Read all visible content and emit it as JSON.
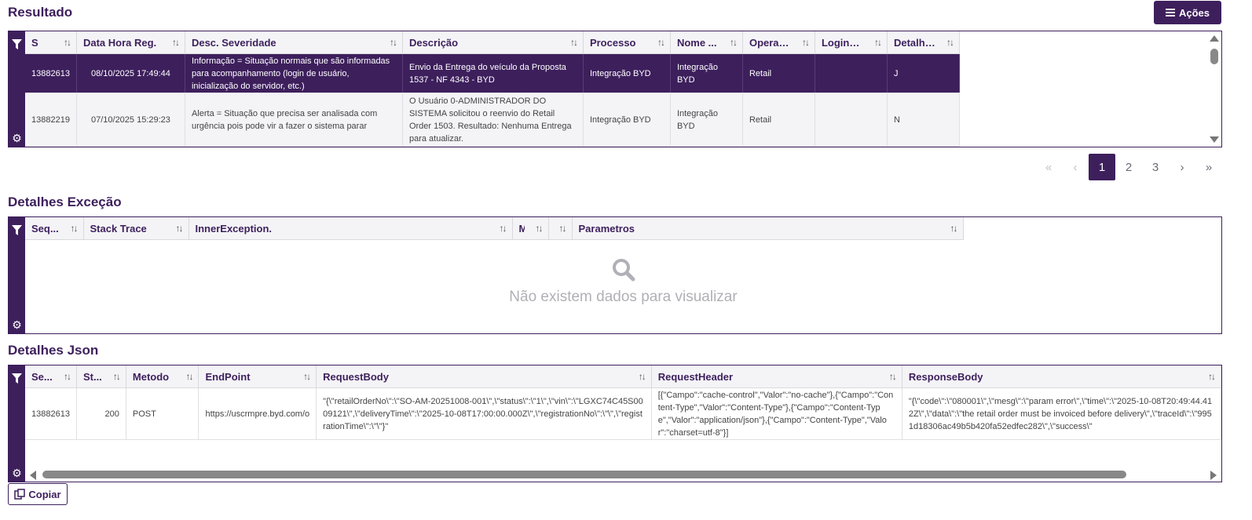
{
  "resultado": {
    "title": "Resultado",
    "acoes_label": "Ações",
    "columns": [
      "S",
      "Data Hora Reg.",
      "Desc. Severidade",
      "Descrição",
      "Processo",
      "Nome ...",
      "Operaç...",
      "LoginU...",
      "Detalhes"
    ],
    "rows": [
      {
        "s": "13882613",
        "data": "08/10/2025 17:49:44",
        "severidade": "Informação = Situação normais que são informadas para acompanhamento (login de usuário, inicialização do servidor, etc.)",
        "descricao": "Envio da Entrega do veículo da Proposta 1537 - NF 4343 - BYD",
        "processo": "Integração BYD",
        "nome": "Integração BYD",
        "operacao": "Retail",
        "login": "",
        "detalhes": "J"
      },
      {
        "s": "13882219",
        "data": "07/10/2025 15:29:23",
        "severidade": "Alerta = Situação que precisa ser analisada com urgência pois pode vir a fazer o sistema parar",
        "descricao": "O Usuário 0-ADMINISTRADOR DO SISTEMA solicitou o reenvio do Retail Order 1503. Resultado: Nenhuma Entrega para atualizar.",
        "processo": "Integração BYD",
        "nome": "Integração BYD",
        "operacao": "Retail",
        "login": "",
        "detalhes": "N"
      }
    ],
    "pagination": {
      "first": "«",
      "prev": "‹",
      "pages": [
        "1",
        "2",
        "3"
      ],
      "active": "1",
      "next": "›",
      "last": "»"
    }
  },
  "excecao": {
    "title": "Detalhes Exceção",
    "columns": [
      "Seq...",
      "Stack Trace",
      "InnerException.",
      "M",
      "",
      "Parametros"
    ],
    "empty_message": "Não existem dados para visualizar"
  },
  "json": {
    "title": "Detalhes Json",
    "columns": [
      "Se...",
      "St...",
      "Metodo",
      "EndPoint",
      "RequestBody",
      "RequestHeader",
      "ResponseBody"
    ],
    "rows": [
      {
        "seq": "13882613",
        "status": "200",
        "metodo": "POST",
        "endpoint": "https://uscrmpre.byd.com/o",
        "request_body": "\"{\\\"retailOrderNo\\\":\\\"SO-AM-20251008-001\\\",\\\"status\\\":\\\"1\\\",\\\"vin\\\":\\\"LGXC74C45S0009121\\\",\\\"deliveryTime\\\":\\\"2025-10-08T17:00:00.000Z\\\",\\\"registrationNo\\\":\\\"\\\",\\\"registrationTime\\\":\\\"\\\"}\"",
        "request_header": "[{\"Campo\":\"cache-control\",\"Valor\":\"no-cache\"},{\"Campo\":\"Content-Type\",\"Valor\":\"Content-Type\"},{\"Campo\":\"Content-Type\",\"Valor\":\"application/json\"},{\"Campo\":\"Content-Type\",\"Valor\":\"charset=utf-8\"}]",
        "response_body": "\"{\\\"code\\\":\\\"080001\\\",\\\"mesg\\\":\\\"param error\\\",\\\"time\\\":\\\"2025-10-08T20:49:44.412Z\\\",\\\"data\\\":\\\"the retail order must be invoiced before delivery\\\",\\\"traceId\\\":\\\"9951d18306ac49b5b420fa52edfec282\\\",\\\"success\\\""
      }
    ]
  },
  "copiar_label": "Copiar",
  "icons": [
    "filter-icon",
    "gear-icon",
    "menu-icon",
    "search-icon",
    "copy-icon",
    "sort-icon"
  ],
  "colors": {
    "primary": "#3d1f5c",
    "header_bg": "#f4f4f7",
    "muted": "#b0b0b6"
  }
}
